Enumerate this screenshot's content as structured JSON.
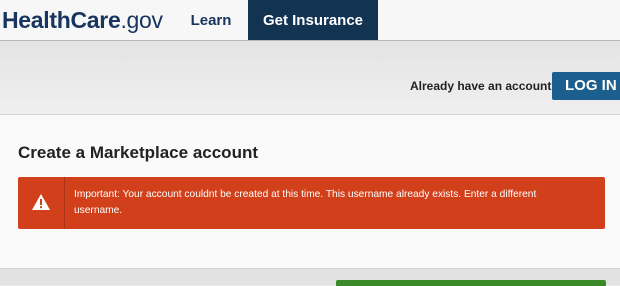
{
  "header": {
    "logo_part1": "HealthCare",
    "logo_part2": ".gov",
    "nav": [
      {
        "label": "Learn"
      },
      {
        "label": "Get Insurance"
      }
    ]
  },
  "account": {
    "prompt": "Already have an account?",
    "login_label": "LOG IN"
  },
  "main": {
    "title": "Create a Marketplace account",
    "alert": {
      "icon": "warning-icon",
      "message": "Important: Your account couldnt be created at this time. This username already exists. Enter a different username."
    }
  },
  "colors": {
    "brand_navy": "#17355e",
    "active_tab": "#123452",
    "login_button": "#1c5f8f",
    "alert_background": "#d1401a",
    "primary_green": "#3a8a2a"
  }
}
